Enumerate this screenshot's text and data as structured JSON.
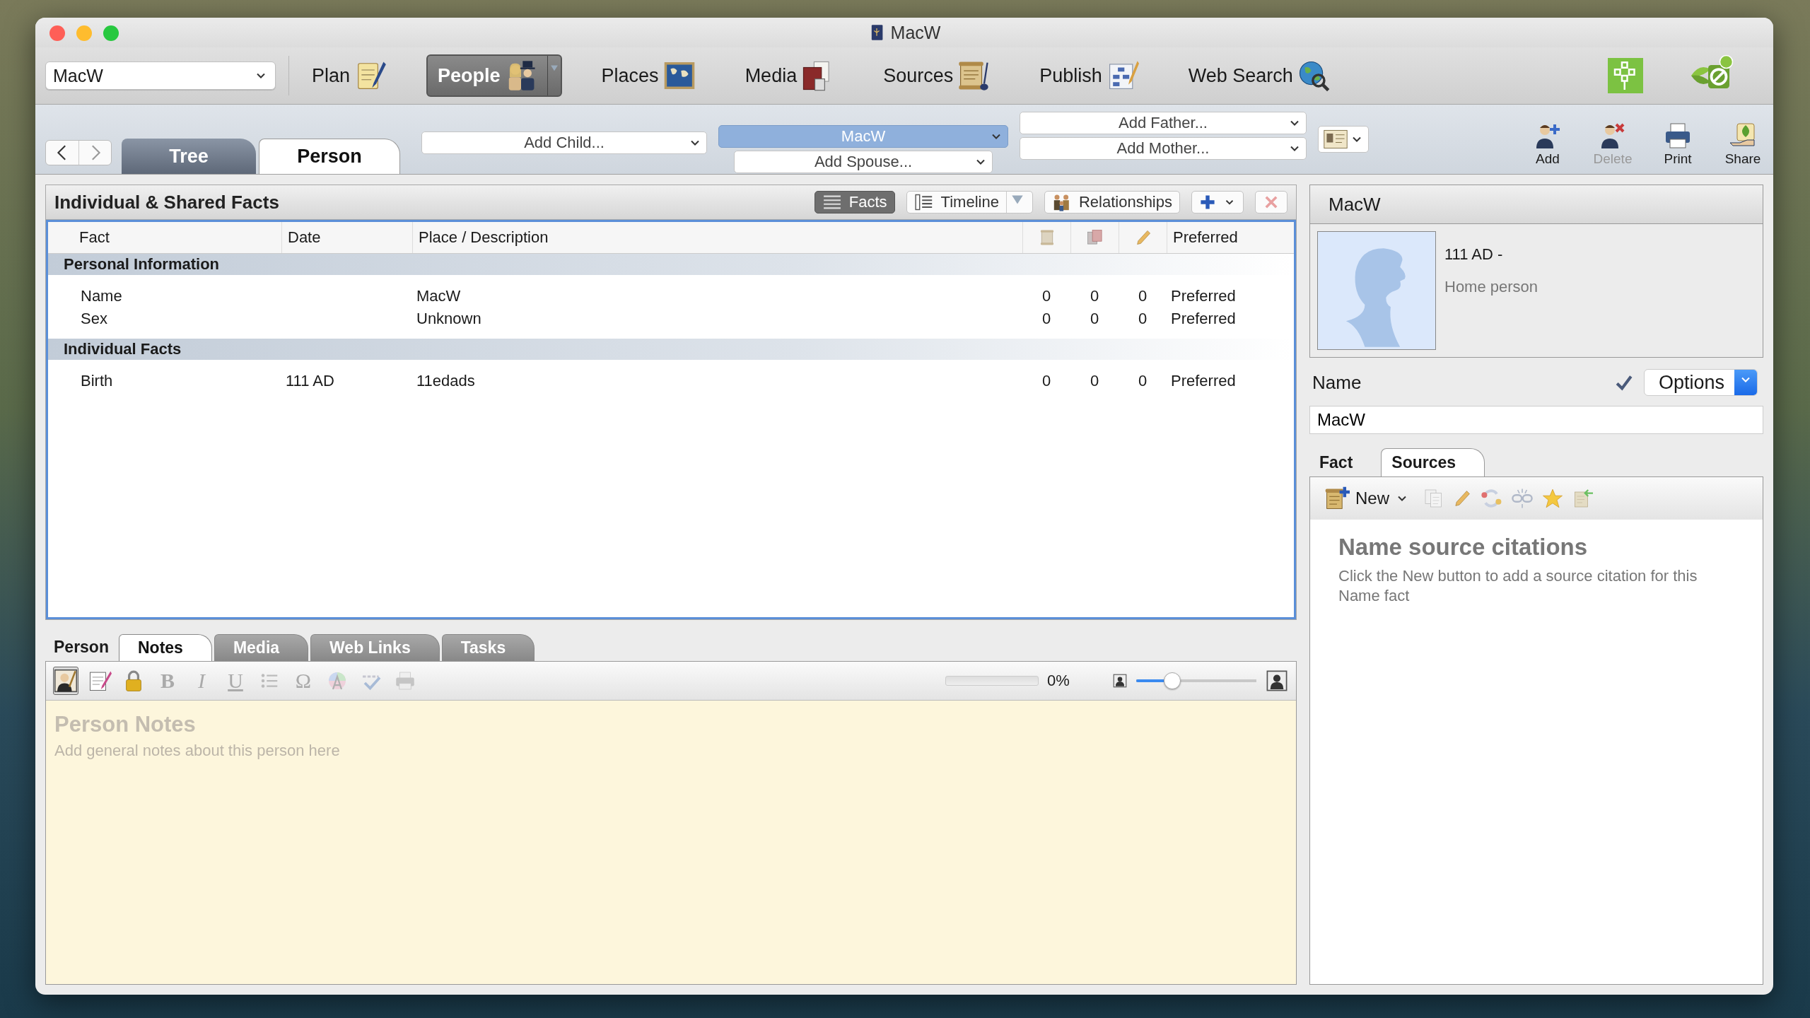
{
  "window": {
    "title": "MacW"
  },
  "toolbar": {
    "person_selector": "MacW",
    "nav": [
      {
        "label": "Plan",
        "selected": false
      },
      {
        "label": "People",
        "selected": true
      },
      {
        "label": "Places",
        "selected": false
      },
      {
        "label": "Media",
        "selected": false
      },
      {
        "label": "Sources",
        "selected": false
      },
      {
        "label": "Publish",
        "selected": false
      },
      {
        "label": "Web Search",
        "selected": false
      }
    ]
  },
  "view_tabs": [
    {
      "label": "Tree",
      "selected": false
    },
    {
      "label": "Person",
      "selected": true
    }
  ],
  "family": {
    "child": "Add Child...",
    "current": "MacW",
    "spouse": "Add Spouse...",
    "father": "Add Father...",
    "mother": "Add Mother..."
  },
  "actions": [
    {
      "label": "Add",
      "disabled": false
    },
    {
      "label": "Delete",
      "disabled": true
    },
    {
      "label": "Print",
      "disabled": false
    },
    {
      "label": "Share",
      "disabled": false
    }
  ],
  "facts_panel": {
    "title": "Individual & Shared Facts",
    "views": [
      {
        "label": "Facts",
        "selected": true
      },
      {
        "label": "Timeline",
        "selected": false
      },
      {
        "label": "Relationships",
        "selected": false
      }
    ],
    "columns": [
      "Fact",
      "Date",
      "Place / Description",
      "Preferred"
    ],
    "sections": [
      {
        "title": "Personal Information",
        "rows": [
          {
            "fact": "Name",
            "place": "MacW",
            "counts": [
              "0",
              "0",
              "0"
            ],
            "preferred": "Preferred"
          },
          {
            "fact": "Sex",
            "place": "Unknown",
            "counts": [
              "0",
              "0",
              "0"
            ],
            "preferred": "Preferred"
          }
        ]
      },
      {
        "title": "Individual Facts",
        "rows": [
          {
            "fact": "Birth",
            "date": "111 AD",
            "place": "11edads",
            "counts": [
              "0",
              "0",
              "0"
            ],
            "preferred": "Preferred"
          }
        ]
      }
    ]
  },
  "bottom_panel": {
    "title": "Person",
    "tabs": [
      {
        "label": "Notes",
        "selected": true
      },
      {
        "label": "Media",
        "selected": false
      },
      {
        "label": "Web Links",
        "selected": false
      },
      {
        "label": "Tasks",
        "selected": false
      }
    ],
    "format_tools": [
      {
        "kind": "bold",
        "glyph": "B",
        "disabled": true
      },
      {
        "kind": "italic",
        "glyph": "I",
        "disabled": true
      },
      {
        "kind": "underline",
        "glyph": "U",
        "disabled": true
      },
      {
        "kind": "list",
        "disabled": true
      },
      {
        "kind": "symbol",
        "glyph": "Ω",
        "disabled": true
      },
      {
        "kind": "color",
        "disabled": true
      },
      {
        "kind": "spelling",
        "disabled": true
      },
      {
        "kind": "print",
        "disabled": true
      }
    ],
    "progress": {
      "level": 0,
      "reading": "0%"
    },
    "zoom": {
      "level": 0.3
    },
    "notes": {
      "title": "Person Notes",
      "placeholder": "Add general notes about this person here"
    }
  },
  "person_card": {
    "name": "MacW",
    "dates": "111 AD -",
    "role": "Home person"
  },
  "name_field": {
    "label": "Name",
    "verified": true,
    "options": "Options",
    "value": "MacW"
  },
  "detail_tabs": [
    {
      "label": "Fact",
      "selected": false
    },
    {
      "label": "Sources",
      "selected": true
    }
  ],
  "sources": {
    "new": "New",
    "title": "Name source citations",
    "message": "Click the New button to add a source citation for this Name fact"
  }
}
